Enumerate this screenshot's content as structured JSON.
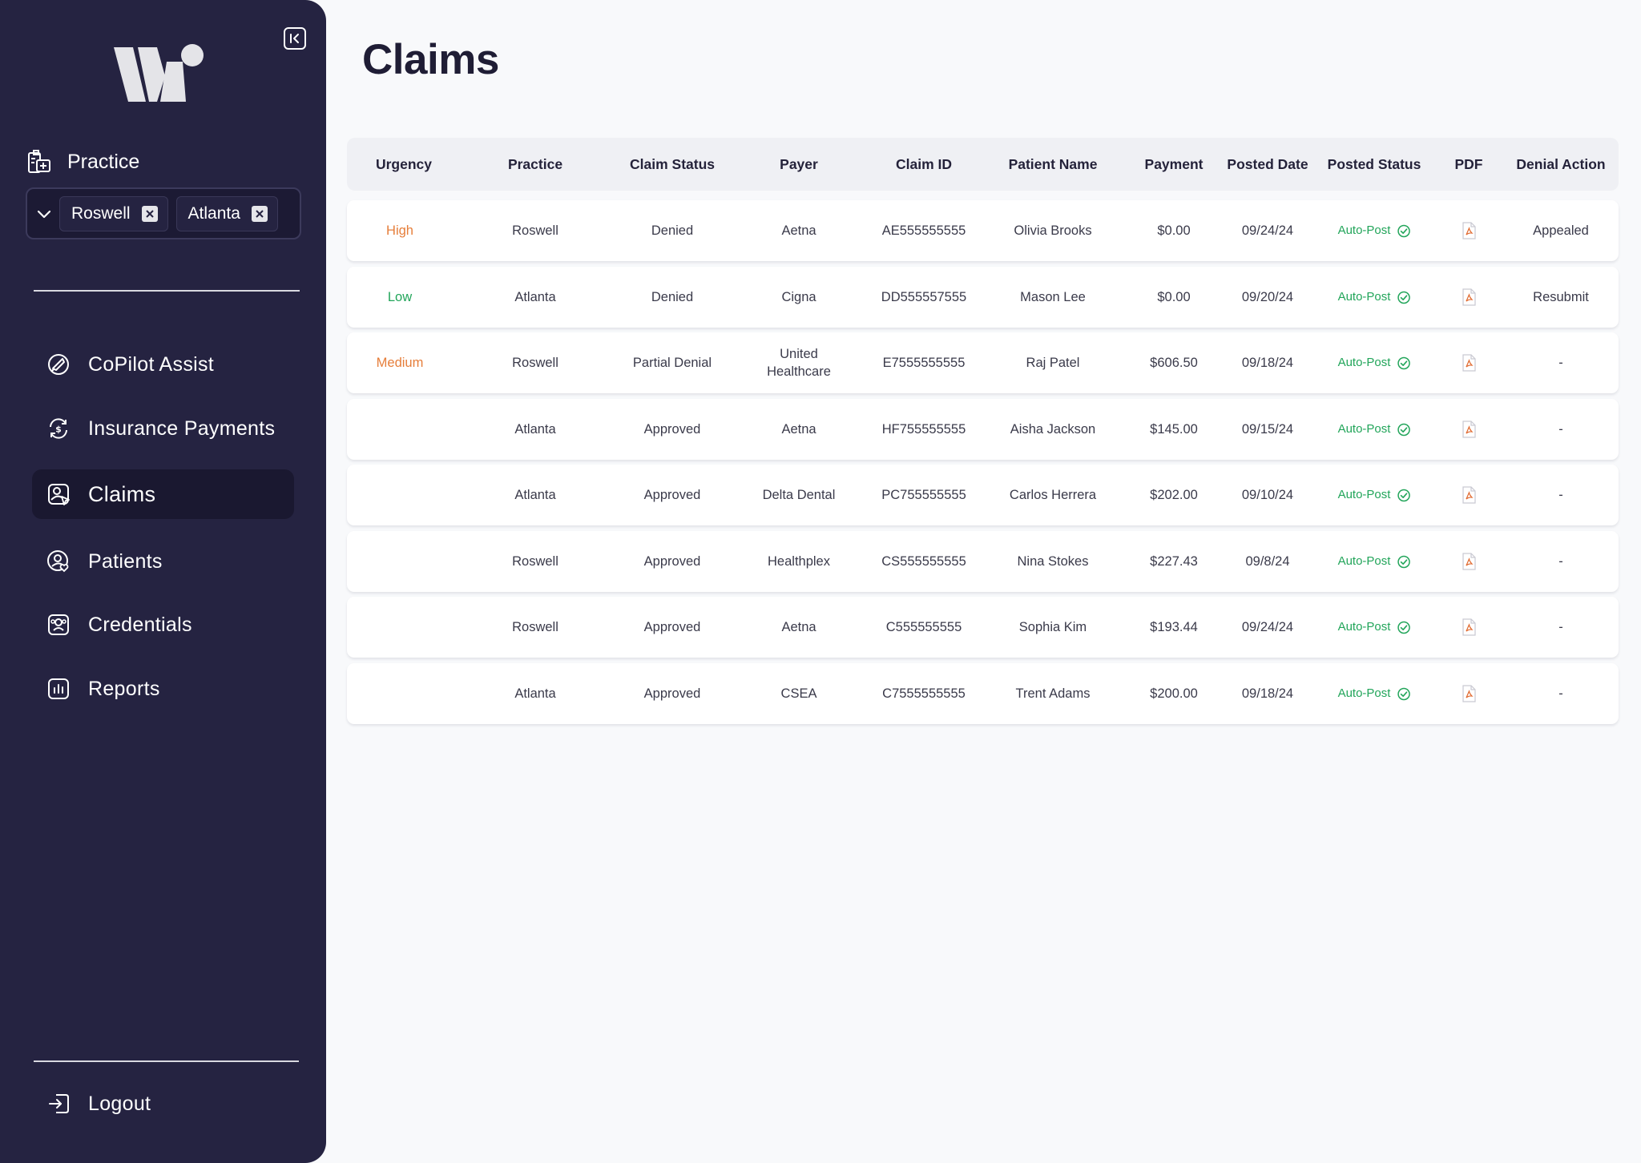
{
  "app": {
    "logo": "Wi"
  },
  "sidebar": {
    "practice_label": "Practice",
    "selected_practices": [
      "Roswell",
      "Atlanta"
    ],
    "nav": [
      {
        "label": "CoPilot Assist",
        "icon": "copilot-icon"
      },
      {
        "label": "Insurance Payments",
        "icon": "insurance-payments-icon"
      },
      {
        "label": "Claims",
        "icon": "claims-icon",
        "active": true
      },
      {
        "label": "Patients",
        "icon": "patients-icon"
      },
      {
        "label": "Credentials",
        "icon": "credentials-icon"
      },
      {
        "label": "Reports",
        "icon": "reports-icon"
      }
    ],
    "logout_label": "Logout"
  },
  "page": {
    "title": "Claims"
  },
  "table": {
    "columns": [
      "Urgency",
      "Practice",
      "Claim Status",
      "Payer",
      "Claim ID",
      "Patient Name",
      "Payment",
      "Posted Date",
      "Posted Status",
      "PDF",
      "Denial Action"
    ],
    "rows": [
      {
        "urgency": "High",
        "practice": "Roswell",
        "claim_status": "Denied",
        "payer": "Aetna",
        "claim_id": "AE555555555",
        "patient_name": "Olivia Brooks",
        "payment": "$0.00",
        "posted_date": "09/24/24",
        "posted_status": "Auto-Post",
        "denial_action": "Appealed"
      },
      {
        "urgency": "Low",
        "practice": "Atlanta",
        "claim_status": "Denied",
        "payer": "Cigna",
        "claim_id": "DD555557555",
        "patient_name": "Mason Lee",
        "payment": "$0.00",
        "posted_date": "09/20/24",
        "posted_status": "Auto-Post",
        "denial_action": "Resubmit"
      },
      {
        "urgency": "Medium",
        "practice": "Roswell",
        "claim_status": "Partial Denial",
        "payer": "United Healthcare",
        "claim_id": "E7555555555",
        "patient_name": "Raj Patel",
        "payment": "$606.50",
        "posted_date": "09/18/24",
        "posted_status": "Auto-Post",
        "denial_action": "-"
      },
      {
        "urgency": "",
        "practice": "Atlanta",
        "claim_status": "Approved",
        "payer": "Aetna",
        "claim_id": "HF755555555",
        "patient_name": "Aisha Jackson",
        "payment": "$145.00",
        "posted_date": "09/15/24",
        "posted_status": "Auto-Post",
        "denial_action": "-"
      },
      {
        "urgency": "",
        "practice": "Atlanta",
        "claim_status": "Approved",
        "payer": "Delta Dental",
        "claim_id": "PC755555555",
        "patient_name": "Carlos Herrera",
        "payment": "$202.00",
        "posted_date": "09/10/24",
        "posted_status": "Auto-Post",
        "denial_action": "-"
      },
      {
        "urgency": "",
        "practice": "Roswell",
        "claim_status": "Approved",
        "payer": "Healthplex",
        "claim_id": "CS555555555",
        "patient_name": "Nina Stokes",
        "payment": "$227.43",
        "posted_date": "09/8/24",
        "posted_status": "Auto-Post",
        "denial_action": "-"
      },
      {
        "urgency": "",
        "practice": "Roswell",
        "claim_status": "Approved",
        "payer": "Aetna",
        "claim_id": "C555555555",
        "patient_name": "Sophia Kim",
        "payment": "$193.44",
        "posted_date": "09/24/24",
        "posted_status": "Auto-Post",
        "denial_action": "-"
      },
      {
        "urgency": "",
        "practice": "Atlanta",
        "claim_status": "Approved",
        "payer": "CSEA",
        "claim_id": "C7555555555",
        "patient_name": "Trent Adams",
        "payment": "$200.00",
        "posted_date": "09/18/24",
        "posted_status": "Auto-Post",
        "denial_action": "-"
      }
    ]
  },
  "colors": {
    "sidebar_bg": "#252341",
    "urgency_high": "#e67e3a",
    "urgency_medium": "#e67e3a",
    "urgency_low": "#22a55a",
    "posted_status": "#22a55a",
    "pdf_icon": "#e0662b"
  }
}
